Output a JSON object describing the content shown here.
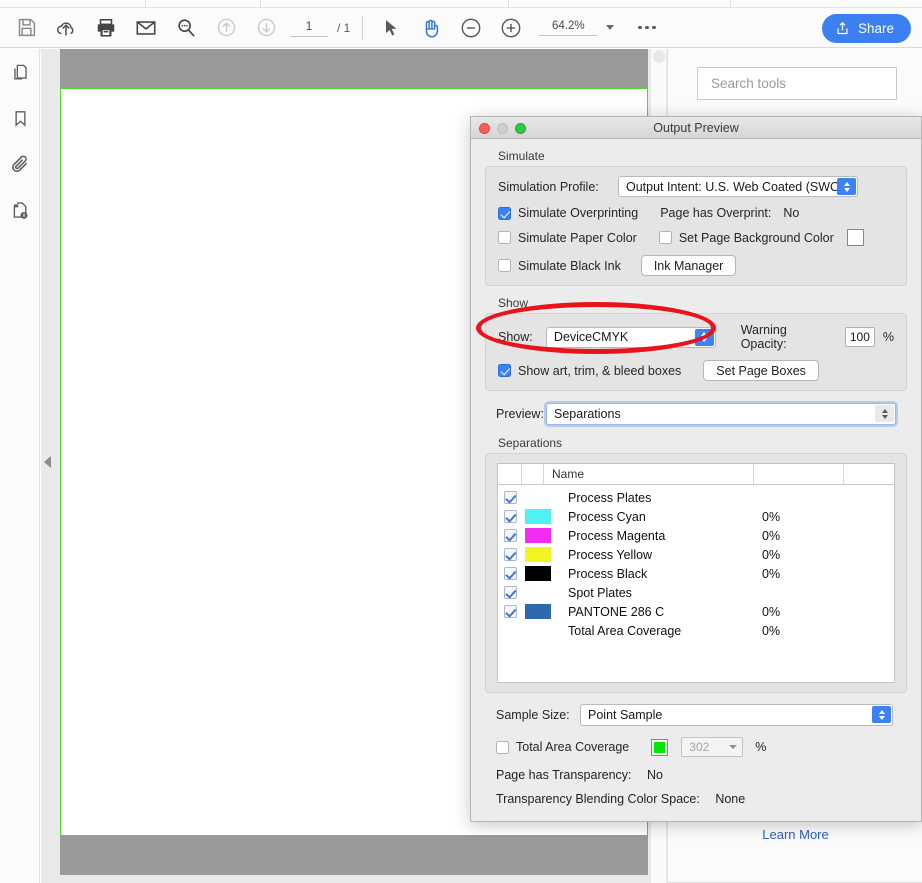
{
  "toolbar": {
    "icons": [
      "save-icon",
      "upload-cloud-icon",
      "print-icon",
      "email-icon",
      "search-zoom-icon",
      "page-up-icon",
      "page-down-icon"
    ],
    "page_current": "1",
    "page_total": "/ 1",
    "select_tool": "cursor-arrow-icon",
    "hand_tool": "hand-icon",
    "zoom_out": "zoom-out-icon",
    "zoom_in": "zoom-in-icon",
    "zoom_level": "64.2%",
    "more_label": "more-options-icon",
    "share_label": "Share"
  },
  "rail": {
    "items": [
      "page-thumbnails-icon",
      "bookmarks-icon",
      "attachments-icon",
      "document-info-icon"
    ]
  },
  "tools_panel": {
    "search_placeholder": "Search tools",
    "learn_more": "Learn More"
  },
  "dialog": {
    "title": "Output Preview",
    "simulate": {
      "group_label": "Simulate",
      "profile_label": "Simulation Profile:",
      "profile_value": "Output Intent: U.S. Web Coated (SWOP)…",
      "overprint_checkbox": "Simulate Overprinting",
      "overprint_checked": true,
      "page_overprint_label": "Page has Overprint:",
      "page_overprint_value": "No",
      "paper_color_checkbox": "Simulate Paper Color",
      "paper_color_checked": false,
      "bg_color_checkbox": "Set Page Background Color",
      "bg_color_checked": false,
      "bg_swatch_color": "#ffffff",
      "black_ink_checkbox": "Simulate Black Ink",
      "black_ink_checked": false,
      "ink_manager_button": "Ink Manager"
    },
    "show": {
      "group_label": "Show",
      "show_label": "Show:",
      "show_value": "DeviceCMYK",
      "warning_opacity_label": "Warning Opacity:",
      "warning_opacity_value": "100",
      "percent": "%",
      "boxes_checkbox": "Show art, trim, & bleed boxes",
      "boxes_checked": true,
      "set_page_boxes_button": "Set Page Boxes"
    },
    "preview": {
      "label": "Preview:",
      "value": "Separations"
    },
    "separations": {
      "group_label": "Separations",
      "columns": [
        "",
        "",
        "Name",
        "",
        ""
      ],
      "rows": [
        {
          "checked": true,
          "swatch": null,
          "name": "Process Plates",
          "value": ""
        },
        {
          "checked": true,
          "swatch": "#4ff2f2",
          "name": "Process Cyan",
          "value": "0%"
        },
        {
          "checked": true,
          "swatch": "#f32cf3",
          "name": "Process Magenta",
          "value": "0%"
        },
        {
          "checked": true,
          "swatch": "#f4f424",
          "name": "Process Yellow",
          "value": "0%"
        },
        {
          "checked": true,
          "swatch": "#000000",
          "name": "Process Black",
          "value": "0%"
        },
        {
          "checked": true,
          "swatch": null,
          "name": "Spot Plates",
          "value": ""
        },
        {
          "checked": true,
          "swatch": "#2e68ad",
          "name": "PANTONE 286 C",
          "value": "0%"
        },
        {
          "checked": null,
          "swatch": null,
          "name": "Total Area Coverage",
          "value": "0%"
        }
      ]
    },
    "sample": {
      "sample_size_label": "Sample Size:",
      "sample_size_value": "Point Sample",
      "tac_checkbox": "Total Area Coverage",
      "tac_checked": false,
      "tac_swatch_color": "#00e800",
      "tac_value": "302",
      "percent": "%",
      "transparency_label": "Page has Transparency:",
      "transparency_value": "No",
      "blending_label": "Transparency Blending Color Space:",
      "blending_value": "None"
    }
  },
  "annotation": {
    "ellipse_color": "#e8141b"
  },
  "document": {
    "page_border_color": "#4cd92a"
  }
}
